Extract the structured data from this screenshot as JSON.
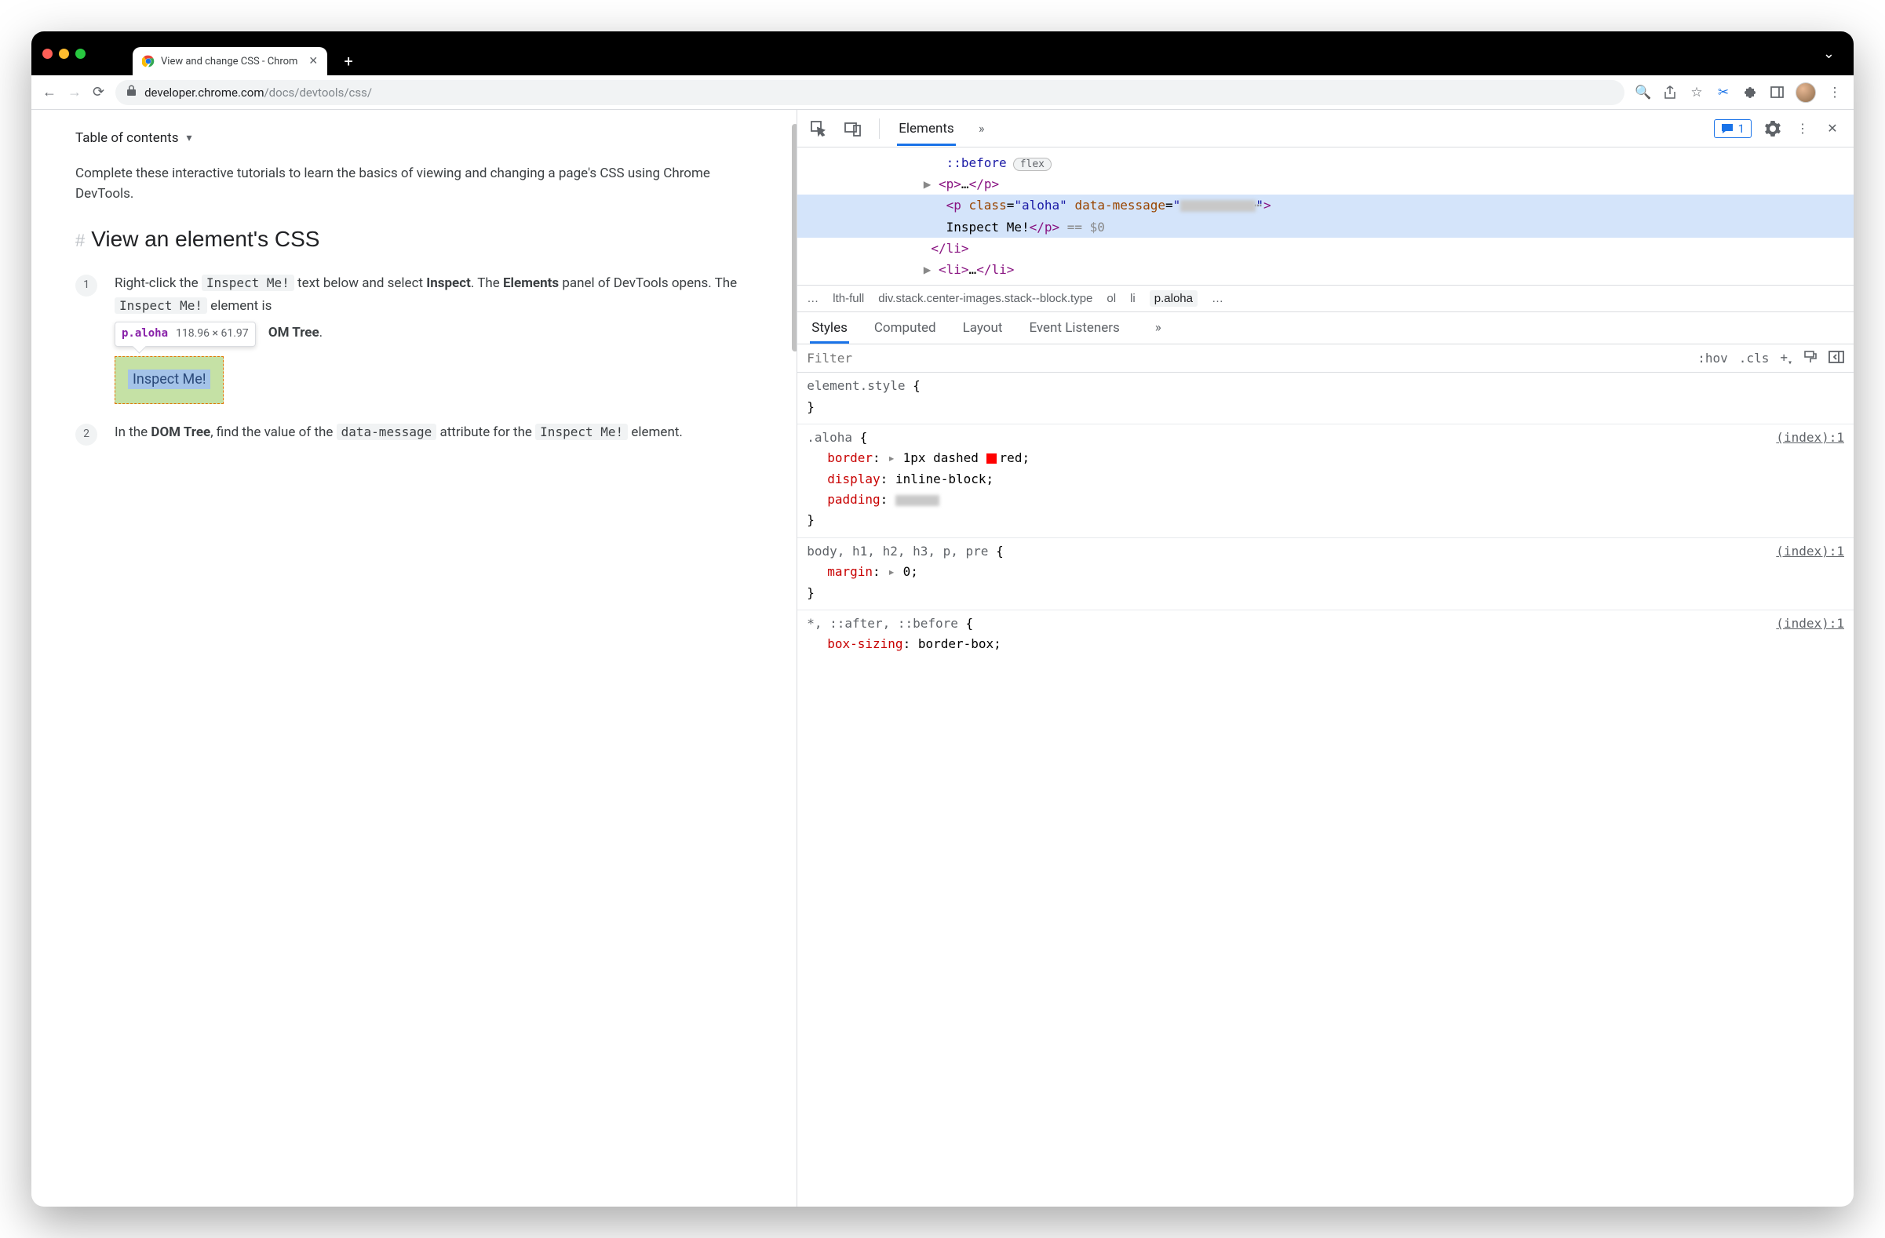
{
  "browser": {
    "tab_title": "View and change CSS - Chrom",
    "url_domain": "developer.chrome.com",
    "url_path": "/docs/devtools/css/"
  },
  "page": {
    "toc": "Table of contents",
    "intro": "Complete these interactive tutorials to learn the basics of viewing and changing a page's CSS using Chrome DevTools.",
    "heading": "View an element's CSS",
    "step1_a": "Right-click the ",
    "step1_code1": "Inspect Me!",
    "step1_b": " text below and select ",
    "step1_bold1": "Inspect",
    "step1_c": ". The ",
    "step1_bold2": "Elements",
    "step1_d": " panel of DevTools opens. The ",
    "step1_code2": "Inspect Me!",
    "step1_e": " element is",
    "step1_trail": "OM Tree",
    "tooltip_selector": "p.aloha",
    "tooltip_dims": "118.96 × 61.97",
    "inspect_text": "Inspect Me!",
    "step2_a": "In the ",
    "step2_bold1": "DOM Tree",
    "step2_b": ", find the value of the ",
    "step2_code1": "data-message",
    "step2_c": " attribute for the ",
    "step2_code2": "Inspect Me!",
    "step2_d": " element."
  },
  "devtools": {
    "panel": "Elements",
    "issues_count": "1",
    "dom": {
      "pseudo": "::before",
      "flex_label": "flex",
      "p_collapsed_open": "<p>",
      "p_collapsed_mid": "…",
      "p_collapsed_close": "</p>",
      "sel_tag_open": "<p ",
      "sel_attr1": "class",
      "sel_val1": "aloha",
      "sel_attr2": "data-message",
      "sel_close": ">",
      "sel_text": "Inspect Me!",
      "sel_endtag": "</p>",
      "sel_eq": " == $0",
      "li_close": "</li>",
      "li2_open": "<li>",
      "li2_mid": "…",
      "li2_close": "</li>"
    },
    "crumbs": {
      "dots": "…",
      "c1": "lth-full",
      "c2": "div.stack.center-images.stack--block.type",
      "c3": "ol",
      "c4": "li",
      "c5": "p.aloha",
      "end": "…"
    },
    "styles_tabs": [
      "Styles",
      "Computed",
      "Layout",
      "Event Listeners"
    ],
    "filter_placeholder": "Filter",
    "filter_hov": ":hov",
    "filter_cls": ".cls",
    "rules": {
      "r0_sel": "element.style ",
      "r1_sel": ".aloha ",
      "r1_src": "(index):1",
      "r1_p1n": "border",
      "r1_p1v": "1px dashed ",
      "r1_p1v2": "red",
      "r1_p2n": "display",
      "r1_p2v": "inline-block",
      "r1_p3n": "padding",
      "r2_sel_dim": "body, h1, h2, h3, ",
      "r2_sel_match": "p",
      "r2_sel_dim2": ", pre ",
      "r2_src": "(index):1",
      "r2_p1n": "margin",
      "r2_p1v": "0",
      "r3_sel_match": "*",
      "r3_sel_dim": ", ::after, ::before ",
      "r3_src": "(index):1",
      "r3_p1n": "box-sizing",
      "r3_p1v": "border-box"
    }
  }
}
